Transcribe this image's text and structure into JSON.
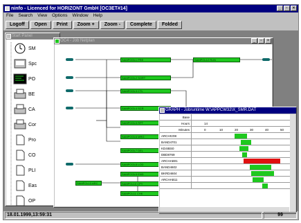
{
  "app": {
    "title": "ninfo - Licenced for HORIZONT GmbH [OC3ET#14]",
    "menu": [
      "File",
      "Search",
      "View",
      "Options",
      "Window",
      "Help"
    ],
    "toolbar": [
      "Logoff",
      "Open",
      "Print",
      "Zoom +",
      "Zoom -",
      "Complete",
      "Folded"
    ],
    "status_left": "18.01.1999,13:59:31",
    "status_right": "99"
  },
  "start_panel": {
    "title": "Start Panel",
    "items": [
      {
        "label": "SM",
        "icon": "clock-icon"
      },
      {
        "label": "Spc",
        "icon": "spool-icon"
      },
      {
        "label": "PO",
        "icon": "terminal-icon"
      },
      {
        "label": "BE",
        "icon": "printer-icon"
      },
      {
        "label": "CA",
        "icon": "printer-icon"
      },
      {
        "label": "Cor",
        "icon": "printer-icon"
      },
      {
        "label": "Pro",
        "icon": "document-icon"
      },
      {
        "label": "CO",
        "icon": "document-icon"
      },
      {
        "label": "PLI",
        "icon": "document-icon"
      },
      {
        "label": "Eas",
        "icon": "document-icon"
      },
      {
        "label": "OP",
        "icon": "document-icon"
      }
    ]
  },
  "job_netplan": {
    "title": "OC4 - Job Netplan",
    "nodes": [
      {
        "label": "SAMPOOL1 PRE"
      },
      {
        "label": "SAMPOOL2 SORT"
      },
      {
        "label": "SAMPOOL3 CTL"
      },
      {
        "label": "SAMPOOL4 SCR"
      },
      {
        "label": "SAMPOOL5 RPT"
      },
      {
        "label": "SAMPOOL6 MRG"
      },
      {
        "label": "SAMPOOL7 DEL"
      },
      {
        "label": "SAMPOOL8 LOD"
      },
      {
        "label": "SAMPOOL9 END"
      },
      {
        "label": "SAMPOL10 CPY"
      },
      {
        "label": "SAMPOL11 CHK"
      },
      {
        "label": "SAMPOL12 RUN"
      },
      {
        "label": "SAMPOL13 ARC"
      },
      {
        "label": "SAMPOL14 BKP"
      },
      {
        "label": "SAMPOL15 FIN"
      }
    ]
  },
  "graph": {
    "title": "GRAPH - Jobruntime W:\\APPCW32\\X_SMR.DAT",
    "header_labels": [
      "Base",
      "Hours",
      "Minutes"
    ],
    "hour_value": "14",
    "minute_ticks": [
      "0",
      "10",
      "20",
      "30",
      "40",
      "50"
    ],
    "jobs": [
      {
        "name": "ARCHIV08",
        "start": 20,
        "end": 28,
        "status": "ok"
      },
      {
        "name": "BAND4701",
        "start": 24,
        "end": 31,
        "status": "ok"
      },
      {
        "name": "KD4IBS0",
        "start": 23,
        "end": 29,
        "status": "ok"
      },
      {
        "name": "DBD8769",
        "start": 25,
        "end": 28,
        "status": "ok"
      },
      {
        "name": "ARCHAB01",
        "start": 26,
        "end": 50,
        "status": "late"
      },
      {
        "name": "BAND4602",
        "start": 30,
        "end": 44,
        "status": "ok"
      },
      {
        "name": "BKRD4604",
        "start": 31,
        "end": 46,
        "status": "ok"
      },
      {
        "name": "ARCHAB11",
        "start": 32,
        "end": 39,
        "status": "ok"
      },
      {
        "name": "",
        "start": 38,
        "end": 42,
        "status": "ok"
      }
    ],
    "colors": {
      "ok": "#1ec81e",
      "late": "#e01010"
    }
  }
}
